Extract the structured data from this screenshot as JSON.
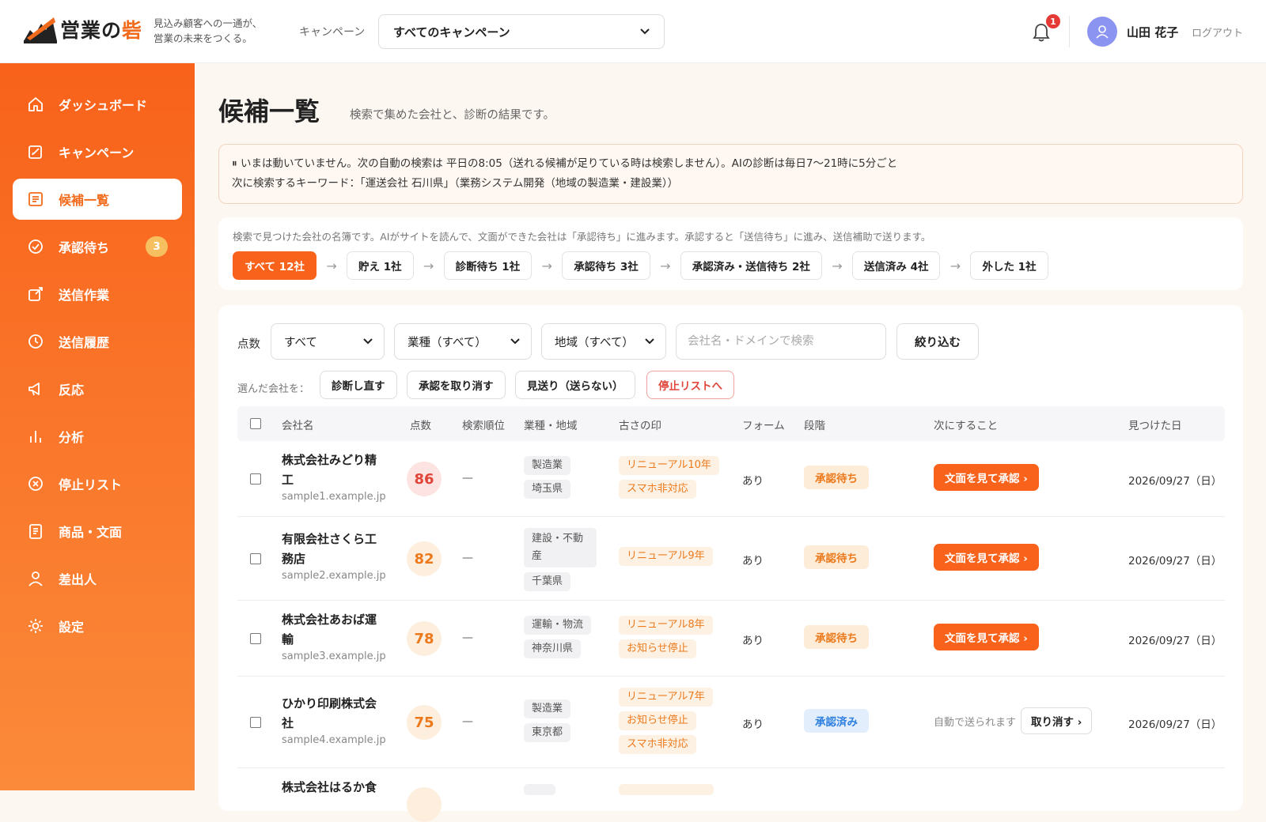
{
  "header": {
    "logo_text": "営業の",
    "logo_accent": "砦",
    "tagline_1": "見込み顧客への一通が、",
    "tagline_2": "営業の未来をつくる。",
    "campaign_label": "キャンペーン",
    "campaign_selected": "すべてのキャンペーン",
    "notification_count": "1",
    "user_name": "山田 花子",
    "logout": "ログアウト"
  },
  "sidebar": {
    "items": [
      {
        "label": "ダッシュボード",
        "icon": "home-icon"
      },
      {
        "label": "キャンペーン",
        "icon": "edit-icon"
      },
      {
        "label": "候補一覧",
        "icon": "list-icon",
        "active": true
      },
      {
        "label": "承認待ち",
        "icon": "check-circle-icon",
        "badge": "3"
      },
      {
        "label": "送信作業",
        "icon": "send-edit-icon"
      },
      {
        "label": "送信履歴",
        "icon": "clock-icon"
      },
      {
        "label": "反応",
        "icon": "megaphone-icon"
      },
      {
        "label": "分析",
        "icon": "bar-chart-icon"
      },
      {
        "label": "停止リスト",
        "icon": "stop-circle-icon"
      },
      {
        "label": "商品・文面",
        "icon": "document-icon"
      },
      {
        "label": "差出人",
        "icon": "user-icon"
      },
      {
        "label": "設定",
        "icon": "gear-icon"
      }
    ]
  },
  "page": {
    "title": "候補一覧",
    "subtitle": "検索で集めた会社と、診断の結果です。"
  },
  "notice": {
    "line1": "⏸ いまは動いていません。次の自動の検索は 平日の8:05（送れる候補が足りている時は検索しません）。AIの診断は毎日7〜21時に5分ごと",
    "line2": "次に検索するキーワード：「運送会社 石川県」（業務システム開発（地域の製造業・建設業））"
  },
  "stages": {
    "description": "検索で見つけた会社の名簿です。AIがサイトを読んで、文面ができた会社は「承認待ち」に進みます。承認すると「送信待ち」に進み、送信補助で送ります。",
    "arrow": "→",
    "items": [
      {
        "label": "すべて 12社",
        "active": true
      },
      {
        "label": "貯え 1社"
      },
      {
        "label": "診断待ち 1社"
      },
      {
        "label": "承認待ち 3社"
      },
      {
        "label": "承認済み・送信待ち 2社"
      },
      {
        "label": "送信済み 4社"
      },
      {
        "label": "外した 1社"
      }
    ]
  },
  "filters": {
    "score_label": "点数",
    "score_value": "すべて",
    "industry_value": "業種（すべて）",
    "region_value": "地域（すべて）",
    "search_placeholder": "会社名・ドメインで検索",
    "search_value": "",
    "apply": "絞り込む"
  },
  "bulk": {
    "label": "選んだ会社を：",
    "rediagnose": "診断し直す",
    "cancel_approval": "承認を取り消す",
    "skip": "見送り（送らない）",
    "stoplist": "停止リストへ"
  },
  "table": {
    "headers": {
      "company": "会社名",
      "score": "点数",
      "rank": "検索順位",
      "industry": "業種・地域",
      "age": "古さの印",
      "form": "フォーム",
      "stage": "段階",
      "next": "次にすること",
      "found": "見つけた日"
    },
    "rows": [
      {
        "name_1": "株式会社みどり精",
        "name_2": "工",
        "domain": "sample1.example.jp",
        "score": "86",
        "rank": "—",
        "tags": [
          "製造業",
          "埼玉県"
        ],
        "age": [
          "リニューアル10年",
          "スマホ非対応"
        ],
        "form": "あり",
        "stage": "承認待ち",
        "action": "文面を見て承認 ›",
        "date": "2026/09/27（日）"
      },
      {
        "name_1": "有限会社さくら工",
        "name_2": "務店",
        "domain": "sample2.example.jp",
        "score": "82",
        "rank": "—",
        "tags_1": "建設・不動",
        "tags_1b": "産",
        "tags_2": "千葉県",
        "age": [
          "リニューアル9年"
        ],
        "form": "あり",
        "stage": "承認待ち",
        "action": "文面を見て承認 ›",
        "date": "2026/09/27（日）"
      },
      {
        "name_1": "株式会社あおば運",
        "name_2": "輸",
        "domain": "sample3.example.jp",
        "score": "78",
        "rank": "—",
        "tags": [
          "運輸・物流",
          "神奈川県"
        ],
        "age": [
          "リニューアル8年",
          "お知らせ停止"
        ],
        "form": "あり",
        "stage": "承認待ち",
        "action": "文面を見て承認 ›",
        "date": "2026/09/27（日）"
      },
      {
        "name_1": "ひかり印刷株式会",
        "name_2": "社",
        "domain": "sample4.example.jp",
        "score": "75",
        "rank": "—",
        "tags": [
          "製造業",
          "東京都"
        ],
        "age": [
          "リニューアル7年",
          "お知らせ停止",
          "スマホ非対応"
        ],
        "form": "あり",
        "stage": "承認済み",
        "auto_note": "自動で送られます",
        "undo": "取り消す ›",
        "date": "2026/09/27（日）"
      },
      {
        "name_1": "株式会社はるか食"
      }
    ]
  },
  "colors": {
    "accent": "#f8621a",
    "score_high_bg": "#fde3e1",
    "score_high_fg": "#e0453a",
    "score_mid_bg": "#fdeedd",
    "score_mid_fg": "#ec7a1c"
  }
}
